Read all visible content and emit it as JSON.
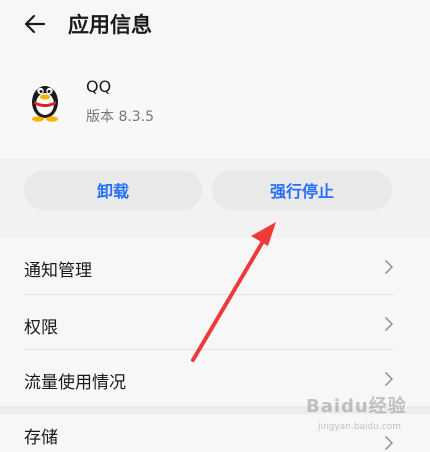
{
  "header": {
    "title": "应用信息",
    "back_icon": "back-arrow-icon"
  },
  "app": {
    "name": "QQ",
    "version": "版本 8.3.5",
    "icon": "qq-penguin-icon"
  },
  "actions": {
    "uninstall_label": "卸载",
    "force_stop_label": "强行停止",
    "accent_color": "#256fff"
  },
  "settings": {
    "items": [
      {
        "label": "通知管理"
      },
      {
        "label": "权限"
      },
      {
        "label": "流量使用情况"
      },
      {
        "label": "存储"
      }
    ]
  },
  "watermark": {
    "logo": "Baidu经验",
    "url": "jingyan.baidu.com"
  },
  "annotation": {
    "arrow_color": "#f03a3a"
  }
}
